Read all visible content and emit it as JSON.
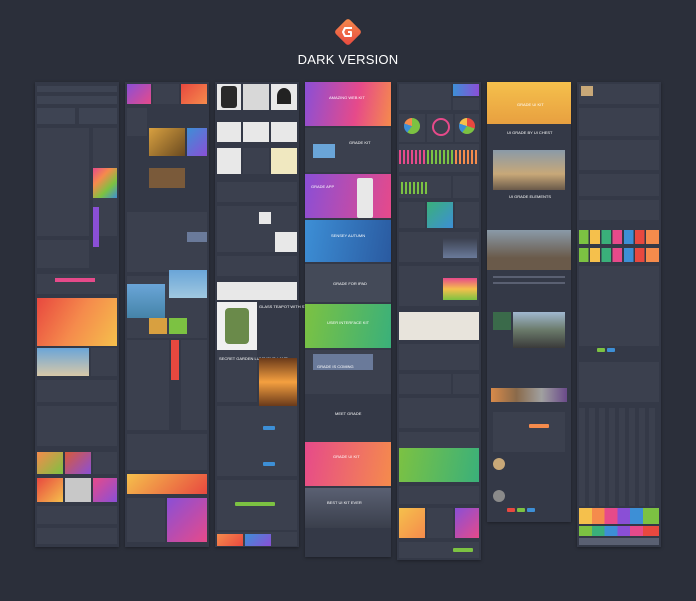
{
  "header": {
    "title": "DARK VERSION",
    "logo_icon": "grade-ui-logo-icon",
    "logo_color": "#f0644b"
  },
  "cards": {
    "amazing_web_kit": "AMAZING WEB KIT",
    "grade_kit": "GRADE KIT",
    "grade_app": "GRADE APP",
    "sensey_autumn": "SENSEY AUTUMN",
    "grade_for_ipad": "GRADE FOR IPAD",
    "user_interface_kit": "USER INTERFACE KIT",
    "grade_is_coming": "GRADE IS COMING",
    "meet_grade": "MEET GRADE",
    "grade_ui_kit": "GRADE UI KIT",
    "best_ui_kit_ever": "BEST UI KIT EVER",
    "ui_grade_by_ui_chest": "UI GRADE BY UI CHEST",
    "ui_grade_elements": "UI GRADE ELEMENTS",
    "glass_teapot": "GLASS TEAPOT WITH STAND",
    "secret_garden_lamp": "SECRET GARDEN LUMINOUS LAMP"
  },
  "colors": {
    "background": "#2b2f3a",
    "panel": "#343947",
    "accent_orange": "#f0644b",
    "accent_green": "#7cc242",
    "accent_blue": "#3d8fd6",
    "accent_purple": "#8a4fd6",
    "accent_pink": "#e64a8a"
  }
}
